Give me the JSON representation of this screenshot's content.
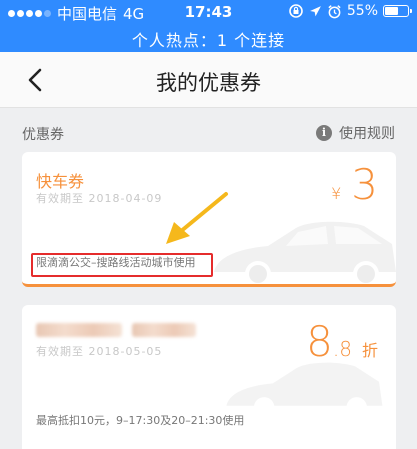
{
  "status_bar": {
    "carrier": "中国电信",
    "network": "4G",
    "time": "17:43",
    "battery": "55%",
    "hotspot": "个人热点：1 个连接"
  },
  "nav": {
    "title": "我的优惠券",
    "back_icon": "chevron-left-icon"
  },
  "section": {
    "label": "优惠券",
    "rules_label": "使用规则",
    "info_icon": "i"
  },
  "coupons": [
    {
      "name": "快车券",
      "expiry": "有效期至 2018-04-09",
      "currency": "¥",
      "amount": "3",
      "condition": "限滴滴公交–搜路线活动城市使用"
    },
    {
      "name": "",
      "expiry": "有效期至 2018-05-05",
      "discount_whole": "8",
      "discount_decimal": ".8",
      "discount_unit": "折",
      "condition": "最高抵扣10元，9–17:30及20–21:30使用"
    }
  ],
  "colors": {
    "status_bar": "#2f8bff",
    "accent": "#f6913c",
    "highlight": "#e52c2c",
    "arrow": "#f5b81c"
  }
}
